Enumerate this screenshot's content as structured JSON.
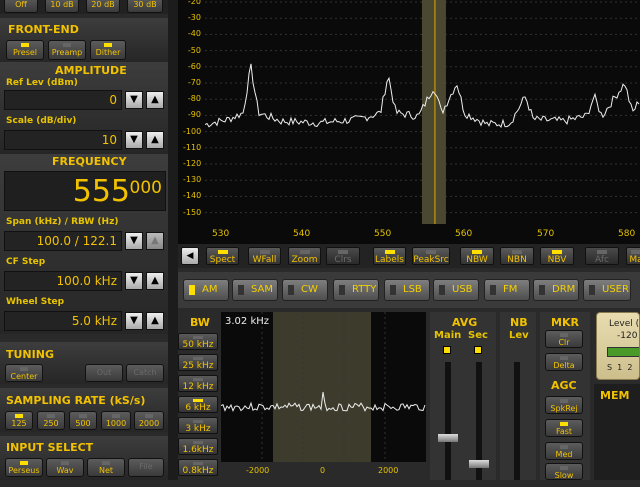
{
  "attenuator": {
    "buttons": [
      "Off",
      "10 dB",
      "20 dB",
      "30 dB"
    ]
  },
  "frontend": {
    "title": "FRONT-END",
    "buttons": [
      {
        "label": "Presel",
        "on": true
      },
      {
        "label": "Preamp",
        "on": false
      },
      {
        "label": "Dither",
        "on": true
      }
    ]
  },
  "amplitude": {
    "title": "AMPLITUDE",
    "ref_label": "Ref Lev (dBm)",
    "ref_value": "0",
    "scale_label": "Scale (dB/div)",
    "scale_value": "10"
  },
  "frequency": {
    "title": "FREQUENCY",
    "main": "555",
    "sub": "000",
    "span_label": "Span (kHz) / RBW (Hz)",
    "span_value": "100.0 / 122.1",
    "cf_label": "CF Step",
    "cf_value": "100.0 kHz",
    "wheel_label": "Wheel Step",
    "wheel_value": "5.0 kHz"
  },
  "tuning": {
    "title": "TUNING",
    "buttons": [
      "Center",
      "Out",
      "Catch"
    ]
  },
  "sampling": {
    "title": "SAMPLING RATE (kS/s)",
    "buttons": [
      "125",
      "250",
      "500",
      "1000",
      "2000"
    ],
    "selected": "125"
  },
  "input": {
    "title": "INPUT SELECT",
    "buttons": [
      "Perseus",
      "Wav",
      "Net",
      "File"
    ],
    "selected": "Perseus"
  },
  "spectrum": {
    "yticks": [
      "-20",
      "-30",
      "-40",
      "-50",
      "-60",
      "-70",
      "-80",
      "-90",
      "-100",
      "-110",
      "-120",
      "-130",
      "-140",
      "-150"
    ],
    "xticks": [
      "530",
      "540",
      "550",
      "560",
      "570",
      "580"
    ]
  },
  "toolbar": {
    "buttons": [
      {
        "label": "Spect",
        "on": true
      },
      {
        "label": "WFall",
        "on": false
      },
      {
        "label": "Zoom",
        "on": false
      },
      {
        "label": "Clrs",
        "on": false
      },
      {
        "label": "Labels",
        "on": true
      },
      {
        "label": "PeakSrc",
        "on": false
      },
      {
        "label": "NBW",
        "on": true
      },
      {
        "label": "NBN",
        "on": false
      },
      {
        "label": "NBV",
        "on": true
      },
      {
        "label": "Afc",
        "on": false
      },
      {
        "label": "Ma",
        "on": false
      }
    ],
    "left_arrow": "◀"
  },
  "modes": {
    "buttons": [
      "AM",
      "SAM",
      "CW",
      "RTTY",
      "LSB",
      "USB",
      "FM",
      "DRM",
      "USER"
    ],
    "selected": "AM"
  },
  "bw": {
    "title": "BW",
    "readout": "3.02 kHz",
    "buttons": [
      "50 kHz",
      "25 kHz",
      "12 kHz",
      "6 kHz",
      "3 kHz",
      "1.6kHz",
      "0.8kHz"
    ],
    "selected": "6 kHz",
    "xticks": [
      "-2000",
      "0",
      "2000"
    ]
  },
  "avg": {
    "title": "AVG",
    "main": "Main",
    "sec": "Sec"
  },
  "nb": {
    "title": "NB",
    "lev": "Lev"
  },
  "mkr": {
    "title": "MKR",
    "buttons": [
      "Clr",
      "Delta"
    ]
  },
  "agc": {
    "title": "AGC",
    "buttons": [
      "SpkRej",
      "Fast",
      "Med",
      "Slow"
    ],
    "selected": "Fast"
  },
  "mem": {
    "title": "MEM"
  },
  "level": {
    "title": "Level (",
    "value": "-120",
    "scale": "S  1  2"
  },
  "chart_data": {
    "type": "line",
    "title": "",
    "xlabel": "",
    "ylabel": "",
    "xlim": [
      525,
      582
    ],
    "ylim": [
      -155,
      -20
    ],
    "peaks_x": [
      531,
      549,
      555,
      558,
      567,
      576,
      580
    ],
    "series": [
      {
        "values": [
          [
            525,
            -95
          ],
          [
            528,
            -92
          ],
          [
            530,
            -88
          ],
          [
            531,
            -60
          ],
          [
            532,
            -88
          ],
          [
            535,
            -93
          ],
          [
            540,
            -94
          ],
          [
            545,
            -92
          ],
          [
            548,
            -88
          ],
          [
            549,
            -65
          ],
          [
            550,
            -88
          ],
          [
            553,
            -90
          ],
          [
            555,
            -72
          ],
          [
            556,
            -88
          ],
          [
            558,
            -70
          ],
          [
            559,
            -88
          ],
          [
            562,
            -95
          ],
          [
            565,
            -94
          ],
          [
            567,
            -78
          ],
          [
            568,
            -92
          ],
          [
            572,
            -93
          ],
          [
            575,
            -90
          ],
          [
            576,
            -78
          ],
          [
            577,
            -90
          ],
          [
            580,
            -70
          ],
          [
            581,
            -88
          ],
          [
            582,
            -80
          ]
        ]
      }
    ],
    "center_x": 555
  }
}
